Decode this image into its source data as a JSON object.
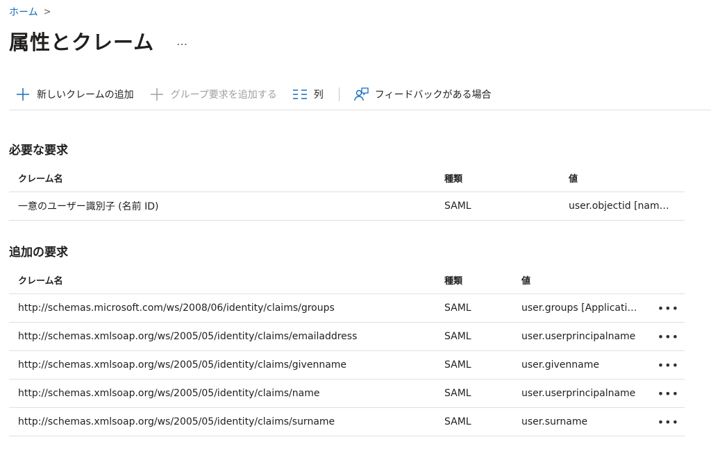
{
  "breadcrumb": {
    "home": "ホーム",
    "separator": ">"
  },
  "page": {
    "title": "属性とクレーム",
    "more": "…"
  },
  "toolbar": {
    "add_claim": "新しいクレームの追加",
    "add_group_claim": "グループ要求を追加する",
    "columns": "列",
    "feedback": "フィードバックがある場合"
  },
  "required": {
    "title": "必要な要求",
    "headers": {
      "name": "クレーム名",
      "type": "種類",
      "value": "値"
    },
    "rows": [
      {
        "name": "一意のユーザー識別子 (名前 ID)",
        "type": "SAML",
        "value": "user.objectid [nam…"
      }
    ]
  },
  "additional": {
    "title": "追加の要求",
    "headers": {
      "name": "クレーム名",
      "type": "種類",
      "value": "値"
    },
    "row_more": "•••",
    "rows": [
      {
        "name": "http://schemas.microsoft.com/ws/2008/06/identity/claims/groups",
        "type": "SAML",
        "value": "user.groups [Applicati…"
      },
      {
        "name": "http://schemas.xmlsoap.org/ws/2005/05/identity/claims/emailaddress",
        "type": "SAML",
        "value": "user.userprincipalname"
      },
      {
        "name": "http://schemas.xmlsoap.org/ws/2005/05/identity/claims/givenname",
        "type": "SAML",
        "value": "user.givenname"
      },
      {
        "name": "http://schemas.xmlsoap.org/ws/2005/05/identity/claims/name",
        "type": "SAML",
        "value": "user.userprincipalname"
      },
      {
        "name": "http://schemas.xmlsoap.org/ws/2005/05/identity/claims/surname",
        "type": "SAML",
        "value": "user.surname"
      }
    ]
  },
  "colors": {
    "accent": "#0f6cbd",
    "border": "#e1dfdd",
    "disabled": "#a19f9d"
  }
}
